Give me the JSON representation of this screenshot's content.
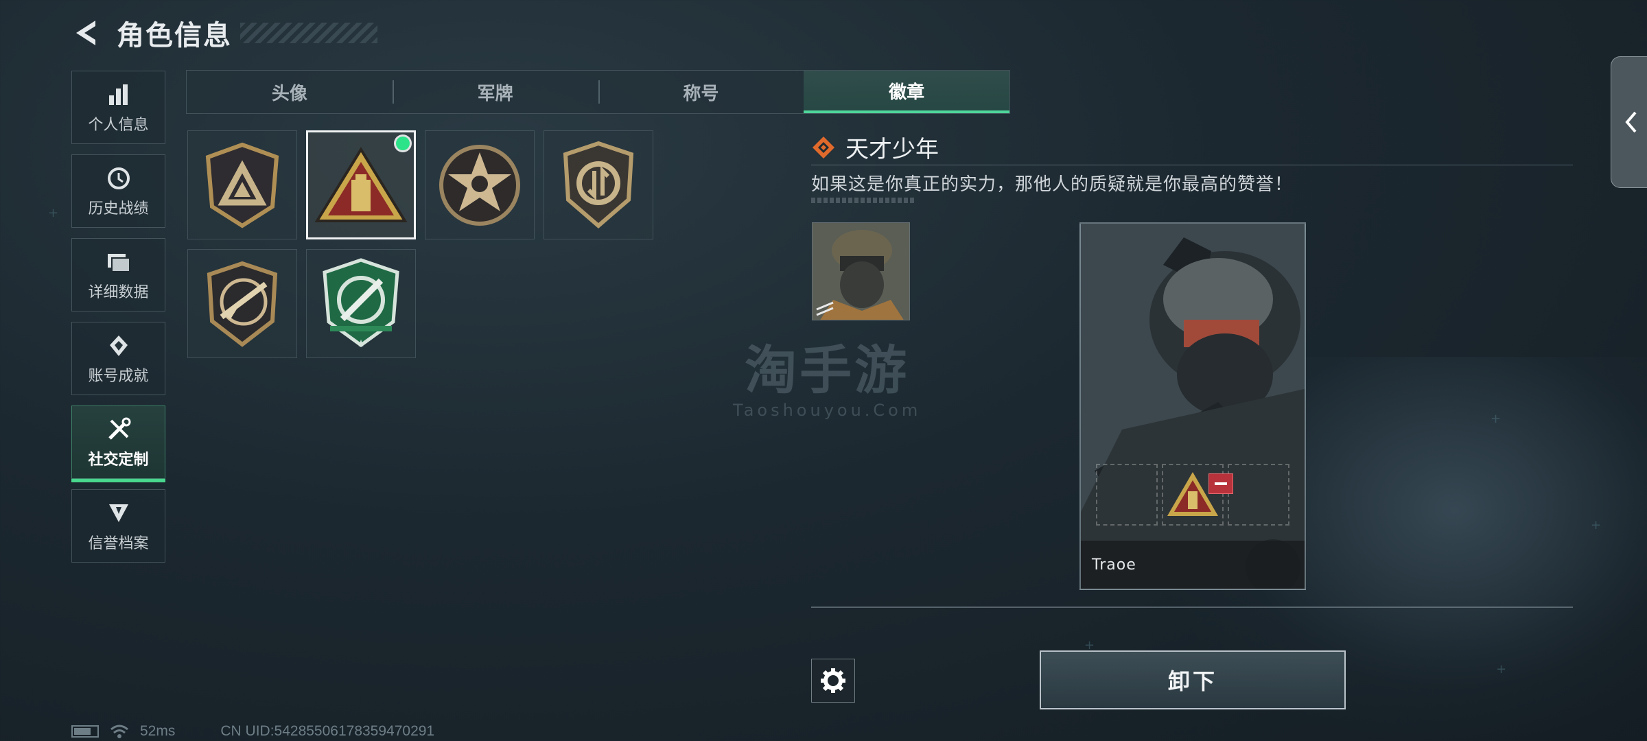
{
  "header": {
    "title": "角色信息"
  },
  "sidebar": {
    "items": [
      {
        "label": "个人信息",
        "icon": "bar-chart-icon"
      },
      {
        "label": "历史战绩",
        "icon": "history-icon"
      },
      {
        "label": "详细数据",
        "icon": "folder-icon"
      },
      {
        "label": "账号成就",
        "icon": "achievement-icon"
      },
      {
        "label": "社交定制",
        "icon": "tools-icon",
        "active": true
      },
      {
        "label": "信誉档案",
        "icon": "shield-badge-icon"
      }
    ]
  },
  "tabs": [
    {
      "label": "头像"
    },
    {
      "label": "军牌"
    },
    {
      "label": "称号"
    },
    {
      "label": "徽章",
      "active": true
    }
  ],
  "badges": [
    {
      "name": "triangle-shield-badge"
    },
    {
      "name": "pyramid-badge",
      "selected": true,
      "equipped": true
    },
    {
      "name": "star-skull-badge"
    },
    {
      "name": "arrows-shield-badge"
    },
    {
      "name": "rifle-badge"
    },
    {
      "name": "green-crosshair-badge"
    }
  ],
  "detail": {
    "name": "天才少年",
    "description": "如果这是你真正的实力，那他人的质疑就是你最高的赞誉！"
  },
  "preview": {
    "player_name": "Traoe"
  },
  "actions": {
    "unequip_label": "卸下"
  },
  "watermark": {
    "main": "淘手游",
    "sub": "Taoshouyou.Com"
  },
  "status": {
    "ping": "52ms",
    "uid": "CN UID:542855061783594702​91"
  },
  "colors": {
    "accent": "#4fd69a",
    "dot": "#2de38a",
    "gold": "#c9a64a",
    "remove": "#b8323c"
  }
}
